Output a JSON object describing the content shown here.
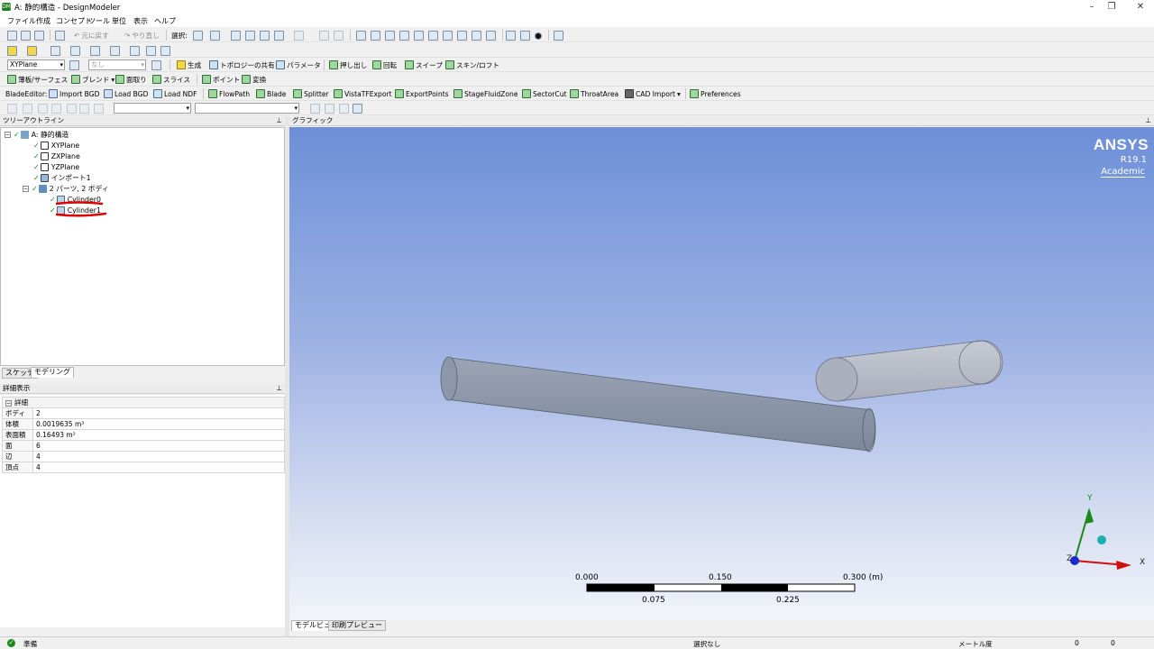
{
  "window": {
    "title": "A: 静的構造 - DesignModeler",
    "app_icon": "DM"
  },
  "menu": [
    "ファイル",
    "作成",
    "コンセプト",
    "ツール",
    "単位",
    "表示",
    "ヘルプ"
  ],
  "toolbar1": {
    "undo_label": "元に戻す",
    "redo_label": "やり直し",
    "select_label": "選択:"
  },
  "toolbar2": {
    "plane_value": "XYPlane",
    "sketch_value": "なし",
    "generate": "生成",
    "share_topology": "トポロジーの共有",
    "parameters": "パラメータ",
    "extrude": "押し出し",
    "revolve": "回転",
    "sweep": "スイープ",
    "skin_loft": "スキン/ロフト"
  },
  "toolbar3": {
    "thin_surface": "薄板/サーフェス",
    "blend": "ブレンド",
    "chamfer": "面取り",
    "slice": "スライス",
    "point": "ポイント",
    "transform": "変換"
  },
  "toolbar4": {
    "blade_editor": "BladeEditor:",
    "import_bgd": "Import BGD",
    "load_bgd": "Load BGD",
    "load_ndf": "Load NDF",
    "flowpath": "FlowPath",
    "blade": "Blade",
    "splitter": "Splitter",
    "vistatf": "VistaTFExport",
    "export_points": "ExportPoints",
    "stage_fluid": "StageFluidZone",
    "sector_cut": "SectorCut",
    "throat_area": "ThroatArea",
    "cad_import": "CAD Import",
    "preferences": "Preferences"
  },
  "tree": {
    "header": "ツリーアウトライン",
    "root": "A: 静的構造",
    "items": [
      "XYPlane",
      "ZXPlane",
      "YZPlane",
      "インポート1"
    ],
    "parts_label": "2 パーツ, 2 ボディ",
    "bodies": [
      "Cylinder0",
      "Cylinder1"
    ],
    "tabs": [
      "スケッチ",
      "モデリング"
    ]
  },
  "details": {
    "header": "詳細表示",
    "section": "詳細",
    "rows": [
      {
        "k": "ボディ",
        "v": "2"
      },
      {
        "k": "体積",
        "v": "0.0019635 m³"
      },
      {
        "k": "表面積",
        "v": "0.16493 m²"
      },
      {
        "k": "面",
        "v": "6"
      },
      {
        "k": "辺",
        "v": "4"
      },
      {
        "k": "頂点",
        "v": "4"
      }
    ]
  },
  "graphics": {
    "header": "グラフィック",
    "brand": "ANSYS",
    "version": "R19.1",
    "edition": "Academic",
    "scale": {
      "top": [
        "0.000",
        "0.150",
        "0.300 (m)"
      ],
      "bottom": [
        "0.075",
        "0.225"
      ]
    },
    "axes": {
      "y": "Y",
      "x": "X",
      "z": "Z"
    },
    "tabs": [
      "モデルビュー",
      "印刷プレビュー"
    ]
  },
  "status": {
    "ready": "準備",
    "selection": "選択なし",
    "unit": "メートル",
    "angle": "度",
    "v1": "0",
    "v2": "0"
  },
  "colors": {
    "check": "#1b8a1b",
    "annotation_red": "#e00000",
    "gradient_top": "#6d8fd8"
  }
}
